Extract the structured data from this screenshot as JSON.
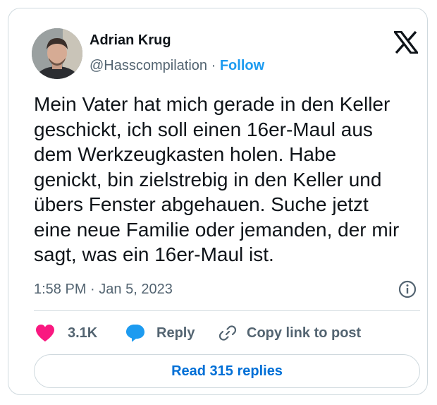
{
  "author": {
    "name": "Adrian Krug",
    "handle": "@Hasscompilation",
    "separator": "·",
    "follow_label": "Follow"
  },
  "tweet": {
    "lines": [
      "Mein Vater hat mich gerade in den Keller",
      "geschickt, ich soll einen 16er-Maul aus",
      "dem Werkzeugkasten holen. Habe",
      "genickt, bin zielstrebig in den Keller und",
      "übers Fenster abgehauen. Suche jetzt",
      "eine neue Familie oder jemanden, der mir",
      "sagt, was ein 16er-Maul ist."
    ],
    "time": "1:58 PM",
    "date_separator": "·",
    "date": "Jan 5, 2023"
  },
  "actions": {
    "likes_count": "3.1K",
    "reply_label": "Reply",
    "copy_link_label": "Copy link to post"
  },
  "read_replies_label": "Read 315 replies",
  "icons": {
    "logo": "x-logo-icon",
    "info": "info-icon",
    "like": "heart-icon",
    "reply": "speech-bubble-icon",
    "copy": "link-icon"
  },
  "colors": {
    "follow_blue": "#1d9bf0",
    "heart_pink": "#f91880",
    "reply_blue": "#1d9bf0",
    "read_replies_blue": "#006fd6",
    "muted_text": "#536471",
    "border": "#cfd9de"
  }
}
